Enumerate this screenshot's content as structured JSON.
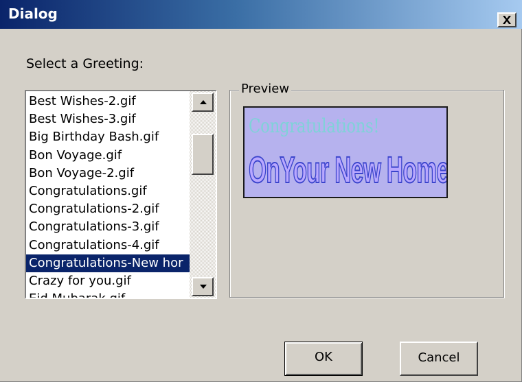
{
  "window": {
    "title": "Dialog",
    "close_icon": "close-icon"
  },
  "greeting": {
    "label": "Select a Greeting:",
    "items": [
      "Best Wishes-2.gif",
      "Best Wishes-3.gif",
      "Big Birthday Bash.gif",
      "Bon Voyage.gif",
      "Bon Voyage-2.gif",
      "Congratulations.gif",
      "Congratulations-2.gif",
      "Congratulations-3.gif",
      "Congratulations-4.gif",
      "Congratulations-New hor",
      "Crazy for you.gif",
      "Eid Mubarak.gif"
    ],
    "selected": "Congratulations-New hor"
  },
  "preview": {
    "legend": "Preview",
    "line1": "Congratulations!",
    "line2": "OnYour New Home!"
  },
  "buttons": {
    "ok": "OK",
    "cancel": "Cancel"
  },
  "colors": {
    "title_start": "#0a246a",
    "title_end": "#a6caf0",
    "selection": "#0a246a",
    "face": "#d4d0c8",
    "preview_bg": "#b6b2ee"
  }
}
